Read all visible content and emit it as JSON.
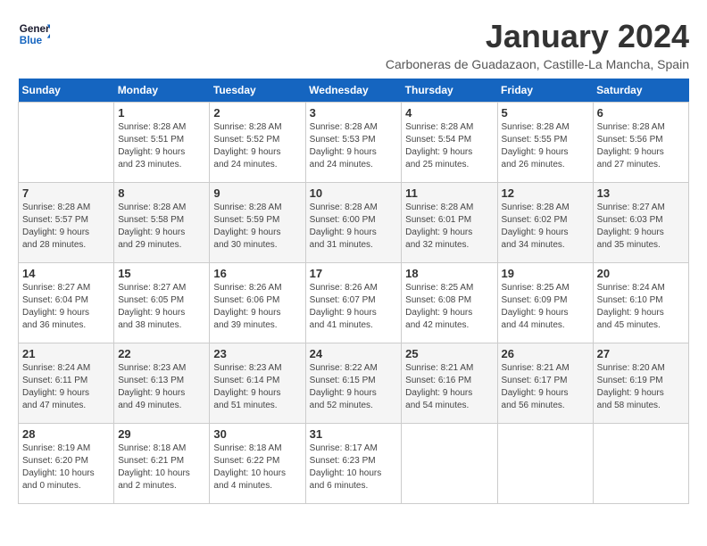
{
  "header": {
    "logo_line1": "General",
    "logo_line2": "Blue",
    "title": "January 2024",
    "subtitle": "Carboneras de Guadazaon, Castille-La Mancha, Spain"
  },
  "days_of_week": [
    "Sunday",
    "Monday",
    "Tuesday",
    "Wednesday",
    "Thursday",
    "Friday",
    "Saturday"
  ],
  "weeks": [
    [
      {
        "day": "",
        "info": ""
      },
      {
        "day": "1",
        "info": "Sunrise: 8:28 AM\nSunset: 5:51 PM\nDaylight: 9 hours\nand 23 minutes."
      },
      {
        "day": "2",
        "info": "Sunrise: 8:28 AM\nSunset: 5:52 PM\nDaylight: 9 hours\nand 24 minutes."
      },
      {
        "day": "3",
        "info": "Sunrise: 8:28 AM\nSunset: 5:53 PM\nDaylight: 9 hours\nand 24 minutes."
      },
      {
        "day": "4",
        "info": "Sunrise: 8:28 AM\nSunset: 5:54 PM\nDaylight: 9 hours\nand 25 minutes."
      },
      {
        "day": "5",
        "info": "Sunrise: 8:28 AM\nSunset: 5:55 PM\nDaylight: 9 hours\nand 26 minutes."
      },
      {
        "day": "6",
        "info": "Sunrise: 8:28 AM\nSunset: 5:56 PM\nDaylight: 9 hours\nand 27 minutes."
      }
    ],
    [
      {
        "day": "7",
        "info": "Sunrise: 8:28 AM\nSunset: 5:57 PM\nDaylight: 9 hours\nand 28 minutes."
      },
      {
        "day": "8",
        "info": "Sunrise: 8:28 AM\nSunset: 5:58 PM\nDaylight: 9 hours\nand 29 minutes."
      },
      {
        "day": "9",
        "info": "Sunrise: 8:28 AM\nSunset: 5:59 PM\nDaylight: 9 hours\nand 30 minutes."
      },
      {
        "day": "10",
        "info": "Sunrise: 8:28 AM\nSunset: 6:00 PM\nDaylight: 9 hours\nand 31 minutes."
      },
      {
        "day": "11",
        "info": "Sunrise: 8:28 AM\nSunset: 6:01 PM\nDaylight: 9 hours\nand 32 minutes."
      },
      {
        "day": "12",
        "info": "Sunrise: 8:28 AM\nSunset: 6:02 PM\nDaylight: 9 hours\nand 34 minutes."
      },
      {
        "day": "13",
        "info": "Sunrise: 8:27 AM\nSunset: 6:03 PM\nDaylight: 9 hours\nand 35 minutes."
      }
    ],
    [
      {
        "day": "14",
        "info": "Sunrise: 8:27 AM\nSunset: 6:04 PM\nDaylight: 9 hours\nand 36 minutes."
      },
      {
        "day": "15",
        "info": "Sunrise: 8:27 AM\nSunset: 6:05 PM\nDaylight: 9 hours\nand 38 minutes."
      },
      {
        "day": "16",
        "info": "Sunrise: 8:26 AM\nSunset: 6:06 PM\nDaylight: 9 hours\nand 39 minutes."
      },
      {
        "day": "17",
        "info": "Sunrise: 8:26 AM\nSunset: 6:07 PM\nDaylight: 9 hours\nand 41 minutes."
      },
      {
        "day": "18",
        "info": "Sunrise: 8:25 AM\nSunset: 6:08 PM\nDaylight: 9 hours\nand 42 minutes."
      },
      {
        "day": "19",
        "info": "Sunrise: 8:25 AM\nSunset: 6:09 PM\nDaylight: 9 hours\nand 44 minutes."
      },
      {
        "day": "20",
        "info": "Sunrise: 8:24 AM\nSunset: 6:10 PM\nDaylight: 9 hours\nand 45 minutes."
      }
    ],
    [
      {
        "day": "21",
        "info": "Sunrise: 8:24 AM\nSunset: 6:11 PM\nDaylight: 9 hours\nand 47 minutes."
      },
      {
        "day": "22",
        "info": "Sunrise: 8:23 AM\nSunset: 6:13 PM\nDaylight: 9 hours\nand 49 minutes."
      },
      {
        "day": "23",
        "info": "Sunrise: 8:23 AM\nSunset: 6:14 PM\nDaylight: 9 hours\nand 51 minutes."
      },
      {
        "day": "24",
        "info": "Sunrise: 8:22 AM\nSunset: 6:15 PM\nDaylight: 9 hours\nand 52 minutes."
      },
      {
        "day": "25",
        "info": "Sunrise: 8:21 AM\nSunset: 6:16 PM\nDaylight: 9 hours\nand 54 minutes."
      },
      {
        "day": "26",
        "info": "Sunrise: 8:21 AM\nSunset: 6:17 PM\nDaylight: 9 hours\nand 56 minutes."
      },
      {
        "day": "27",
        "info": "Sunrise: 8:20 AM\nSunset: 6:19 PM\nDaylight: 9 hours\nand 58 minutes."
      }
    ],
    [
      {
        "day": "28",
        "info": "Sunrise: 8:19 AM\nSunset: 6:20 PM\nDaylight: 10 hours\nand 0 minutes."
      },
      {
        "day": "29",
        "info": "Sunrise: 8:18 AM\nSunset: 6:21 PM\nDaylight: 10 hours\nand 2 minutes."
      },
      {
        "day": "30",
        "info": "Sunrise: 8:18 AM\nSunset: 6:22 PM\nDaylight: 10 hours\nand 4 minutes."
      },
      {
        "day": "31",
        "info": "Sunrise: 8:17 AM\nSunset: 6:23 PM\nDaylight: 10 hours\nand 6 minutes."
      },
      {
        "day": "",
        "info": ""
      },
      {
        "day": "",
        "info": ""
      },
      {
        "day": "",
        "info": ""
      }
    ]
  ]
}
